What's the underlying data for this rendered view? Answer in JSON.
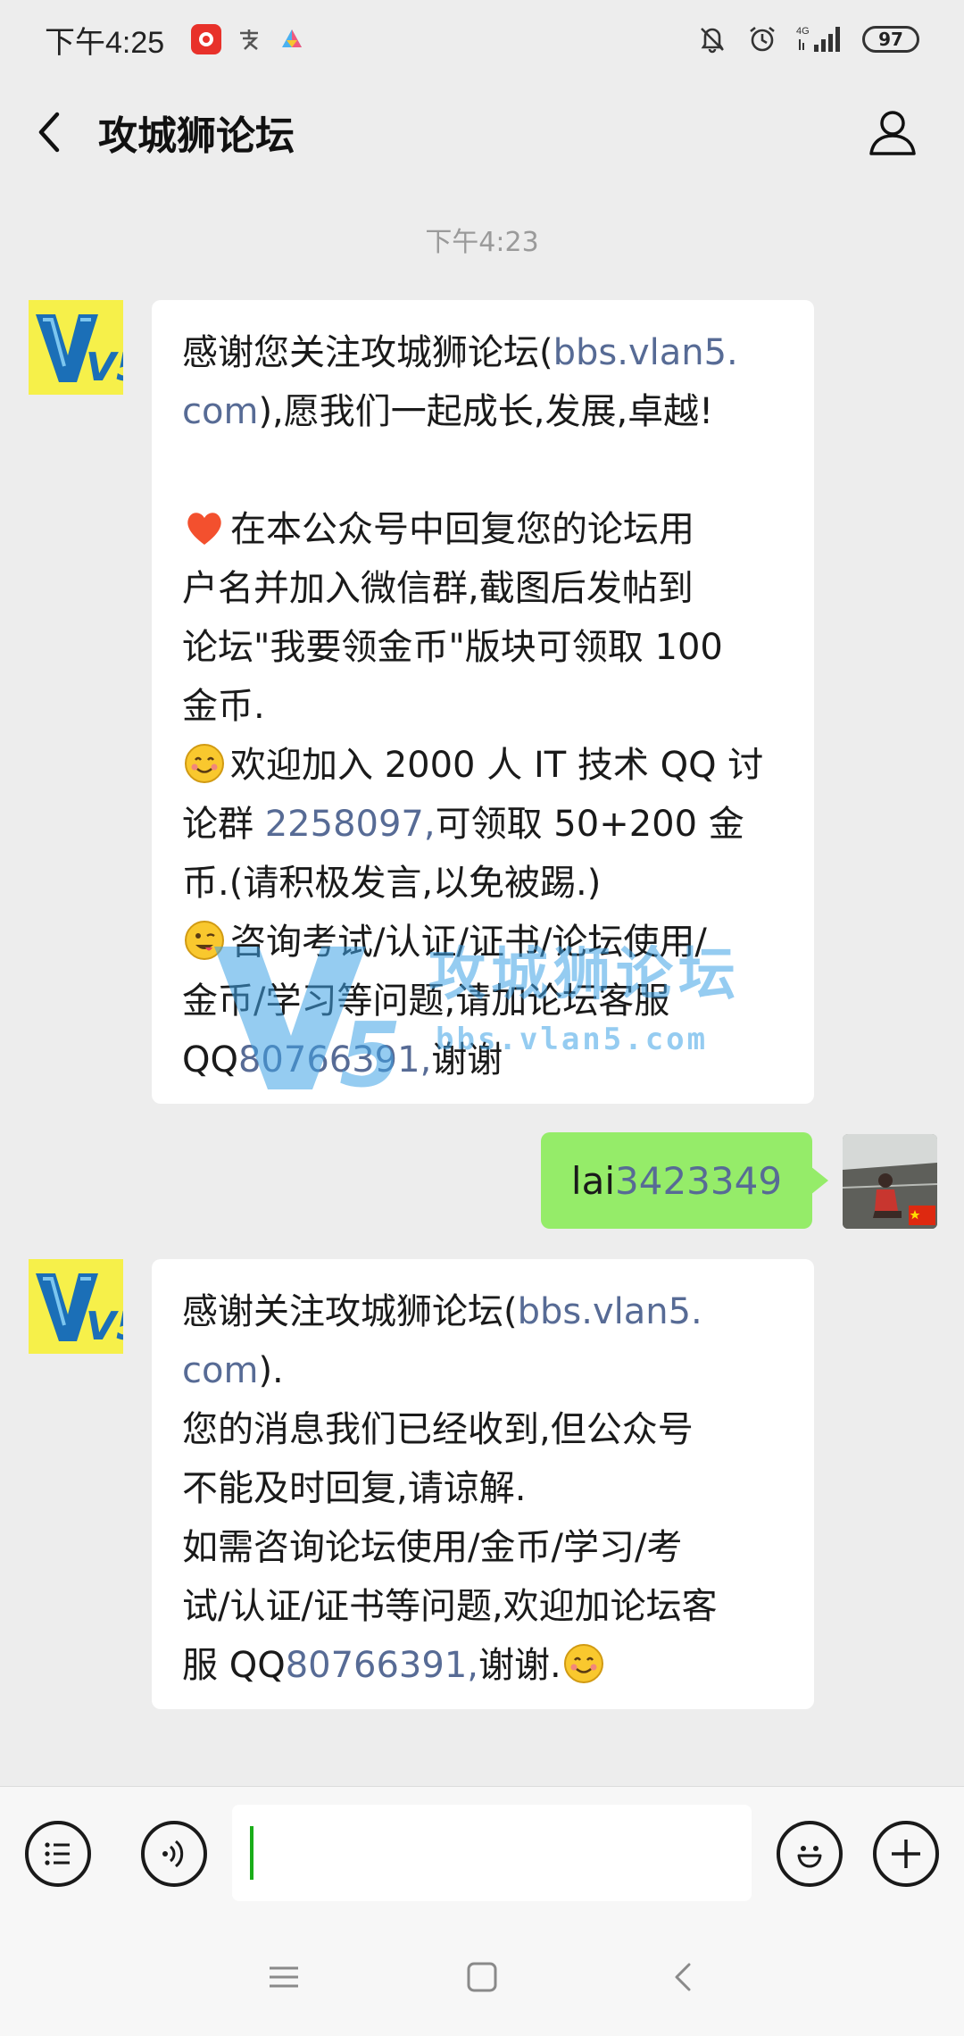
{
  "status_bar": {
    "time": "下午4:25",
    "network": "4G",
    "battery": "97"
  },
  "header": {
    "title": "攻城狮论坛"
  },
  "chat": {
    "timestamp": "下午4:23",
    "messages": [
      {
        "sender": "V5",
        "lines": [
          {
            "parts": [
              {
                "t": "感谢您关注攻城狮论坛("
              },
              {
                "t": "bbs.vlan5.",
                "link": true
              }
            ]
          },
          {
            "parts": [
              {
                "t": "com",
                "link": true
              },
              {
                "t": "),愿我们一起成长,发展,卓越!"
              }
            ]
          },
          {
            "parts": [
              {
                "t": " "
              }
            ]
          },
          {
            "parts": [
              {
                "emoji": "heart"
              },
              {
                "t": "在本公众号中回复您的论坛用"
              }
            ]
          },
          {
            "parts": [
              {
                "t": "户名并加入微信群,截图后发帖到"
              }
            ]
          },
          {
            "parts": [
              {
                "t": "论坛\"我要领金币\"版块可领取 100"
              }
            ]
          },
          {
            "parts": [
              {
                "t": "金币."
              }
            ]
          },
          {
            "parts": [
              {
                "emoji": "smile"
              },
              {
                "t": "欢迎加入 2000 人 IT 技术 QQ 讨"
              }
            ]
          },
          {
            "parts": [
              {
                "t": "论群 "
              },
              {
                "t": "2258097,",
                "link": true
              },
              {
                "t": "可领取 50+200 金"
              }
            ]
          },
          {
            "parts": [
              {
                "t": "币.(请积极发言,以免被踢.)"
              }
            ]
          },
          {
            "parts": [
              {
                "emoji": "wink"
              },
              {
                "t": "咨询考试/认证/证书/论坛使用/"
              }
            ]
          },
          {
            "parts": [
              {
                "t": "金币/学习等问题,请加论坛客服"
              }
            ]
          },
          {
            "parts": [
              {
                "t": "QQ"
              },
              {
                "t": "80766391,",
                "link": true
              },
              {
                "t": "谢谢"
              }
            ]
          }
        ]
      },
      {
        "sender": "me",
        "parts": [
          {
            "t": "lai"
          },
          {
            "t": "3423349",
            "link": true
          }
        ]
      },
      {
        "sender": "V5",
        "lines": [
          {
            "parts": [
              {
                "t": "感谢关注攻城狮论坛("
              },
              {
                "t": "bbs.vlan5.",
                "link": true
              }
            ]
          },
          {
            "parts": [
              {
                "t": "com",
                "link": true
              },
              {
                "t": ")."
              }
            ]
          },
          {
            "parts": [
              {
                "t": "您的消息我们已经收到,但公众号"
              }
            ]
          },
          {
            "parts": [
              {
                "t": "不能及时回复,请谅解."
              }
            ]
          },
          {
            "parts": [
              {
                "t": "如需咨询论坛使用/金币/学习/考"
              }
            ]
          },
          {
            "parts": [
              {
                "t": "试/认证/证书等问题,欢迎加论坛客"
              }
            ]
          },
          {
            "parts": [
              {
                "t": "服 QQ"
              },
              {
                "t": "80766391,",
                "link": true
              },
              {
                "t": "谢谢."
              },
              {
                "emoji": "smile"
              }
            ]
          }
        ]
      }
    ]
  },
  "avatar_text": "V5",
  "watermark": {
    "title": "攻城狮论坛",
    "url": "bbs.vlan5.com"
  },
  "colors": {
    "link": "#576b95",
    "outgoing_bubble": "#95ec69",
    "background": "#ededed"
  },
  "icons": [
    "back-arrow-icon",
    "person-icon",
    "menu-list-icon",
    "voice-icon",
    "emoji-icon",
    "plus-icon",
    "nav-menu-icon",
    "nav-home-icon",
    "nav-back-icon"
  ]
}
